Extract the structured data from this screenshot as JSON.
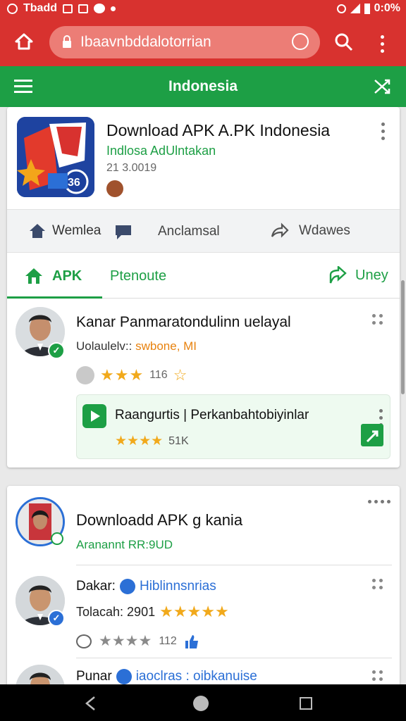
{
  "status": {
    "left_text": "Tbadd",
    "right_text": "0:0%"
  },
  "browser": {
    "url": "Ibaavnbddalotorrian"
  },
  "appbar": {
    "title": "Indonesia"
  },
  "app": {
    "title": "Download APK A.PK Indonesia",
    "subtitle": "Indlosa AdUlntakan",
    "meta": "21 3.0019",
    "actions": {
      "a1": "Wemlea",
      "a2": "Anclamsal",
      "a3": "Wdawes"
    }
  },
  "tabs": {
    "t1": "APK",
    "t2": "Ptenoute",
    "t3": "Uney"
  },
  "reviews": [
    {
      "name": "Kanar Panmaratondulinn uelayal",
      "handle": "Uolaulelv::",
      "tag": "swbone, MI",
      "count": "116"
    }
  ],
  "promo": {
    "title": "Raangurtis | Perkanbahtobiyinlar",
    "rating": "51K"
  },
  "card2": {
    "title": "Downloadd APK g kania",
    "sub": "Aranannt RR:9UD"
  },
  "people": [
    {
      "name": "Dakar:",
      "tag": "Hiblinnsnrias",
      "line2": "Tolacah: 2901",
      "count": "112"
    },
    {
      "name": "Punar",
      "tag": "iaoclras : oibkanuise"
    }
  ],
  "colors": {
    "red": "#d8322f",
    "green": "#1d9f45",
    "star": "#f1a91b",
    "blue": "#2b6fd6"
  }
}
